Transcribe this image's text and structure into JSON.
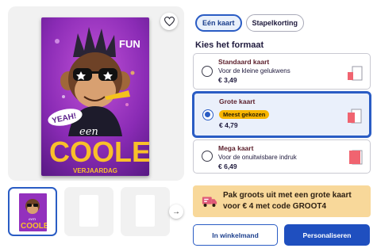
{
  "product": {
    "card_art": {
      "badge_text": "FUN",
      "bubble_text": "YEAH!",
      "script_text": "een",
      "big_text": "COOLE",
      "sub_text": "VERJAARDAG",
      "colors": {
        "bg": "#8e2fb8",
        "accent": "#f9c02a"
      }
    },
    "thumbnail_art": {
      "script_text": "een",
      "big_text": "COOLE"
    },
    "favorite_icon": "heart-icon",
    "next_icon": "arrow-right-icon"
  },
  "tabs": [
    {
      "label": "Eén kaart",
      "active": true
    },
    {
      "label": "Stapelkorting",
      "active": false
    }
  ],
  "format": {
    "title": "Kies het formaat",
    "options": [
      {
        "name": "Standaard kaart",
        "description": "Voor de kleine gelukwens",
        "price": "€ 3,49",
        "selected": false,
        "badge": ""
      },
      {
        "name": "Grote kaart",
        "description": "",
        "price": "€ 4,79",
        "selected": true,
        "badge": "Meest gekozen"
      },
      {
        "name": "Mega kaart",
        "description": "Voor de onuitwisbare indruk",
        "price": "€ 6,49",
        "selected": false,
        "badge": ""
      }
    ]
  },
  "promo": {
    "text": "Pak groots uit met een grote kaart voor € 4 met code GROOT4",
    "icon": "delivery-truck-icon",
    "color": "#f8d89a"
  },
  "actions": {
    "cart_label": "In winkelmand",
    "personalize_label": "Personaliseren"
  },
  "colors": {
    "primary": "#1f4fbf",
    "badge": "#f7b500",
    "size_icon": "#f06470"
  }
}
